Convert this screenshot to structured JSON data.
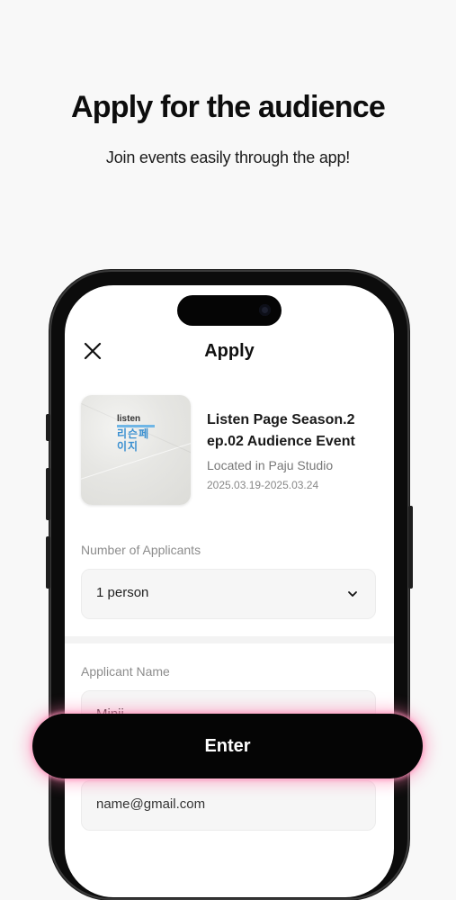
{
  "hero": {
    "title": "Apply for the audience",
    "subtitle": "Join events easily through the app!"
  },
  "screen": {
    "nav": {
      "close_icon": "close-icon",
      "title": "Apply"
    },
    "event": {
      "thumbnail_logo_en": "listen",
      "thumbnail_logo_kr": "리슨페이지",
      "title": "Listen Page Season.2 ep.02 Audience Event",
      "location": "Located in Paju Studio",
      "dates": "2025.03.19-2025.03.24"
    },
    "applicants": {
      "label": "Number of Applicants",
      "value": "1 person",
      "chevron_icon": "chevron-down-icon"
    },
    "applicant_name": {
      "label": "Applicant Name",
      "value": "Minji"
    },
    "email": {
      "value": "name@gmail.com"
    }
  },
  "cta": {
    "label": "Enter"
  },
  "colors": {
    "background": "#f8f8f8",
    "button": "#050505",
    "button_glow": "#ff78aa",
    "field_bg": "#f6f6f6",
    "label_gray": "#8c8c8c"
  }
}
